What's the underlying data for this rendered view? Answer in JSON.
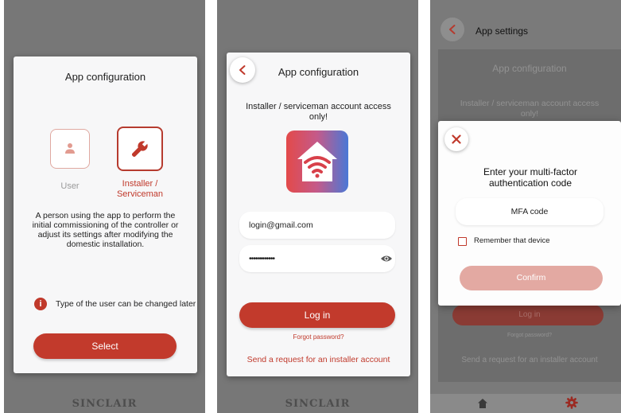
{
  "screen1": {
    "title": "App configuration",
    "roles": [
      {
        "label": "User",
        "icon": "person-icon",
        "selected": false
      },
      {
        "label": "Installer / Serviceman",
        "icon": "wrench-icon",
        "selected": true
      }
    ],
    "description": "A person using the app to perform the initial commissioning of the controller or adjust its settings after modifying the domestic installation.",
    "info_text": "Type of the user can be changed later",
    "select_button": "Select",
    "footer_logo": "SINCLAIR"
  },
  "screen2": {
    "title": "App configuration",
    "subtitle": "Installer / serviceman account access only!",
    "email_value": "login@gmail.com",
    "password_value": "••••••••••••",
    "login_button": "Log in",
    "forgot_link": "Forgot password?",
    "request_link": "Send a request for an installer account",
    "footer_logo": "SINCLAIR"
  },
  "screen3": {
    "header_title": "App settings",
    "bg_title": "App configuration",
    "bg_subtitle": "Installer / serviceman account access only!",
    "bg_login": "Log in",
    "bg_forgot": "Forgot password?",
    "bg_request": "Send a request for an installer account",
    "modal": {
      "title": "Enter your multi-factor authentication code",
      "mfa_placeholder": "MFA code",
      "remember_label": "Remember that device",
      "remember_checked": false,
      "confirm_button": "Confirm"
    },
    "nav_icons": [
      "home-icon",
      "gear-icon"
    ]
  },
  "colors": {
    "accent": "#c23a2c",
    "accent_disabled": "#e3a9a2",
    "overlay": "#777777"
  }
}
